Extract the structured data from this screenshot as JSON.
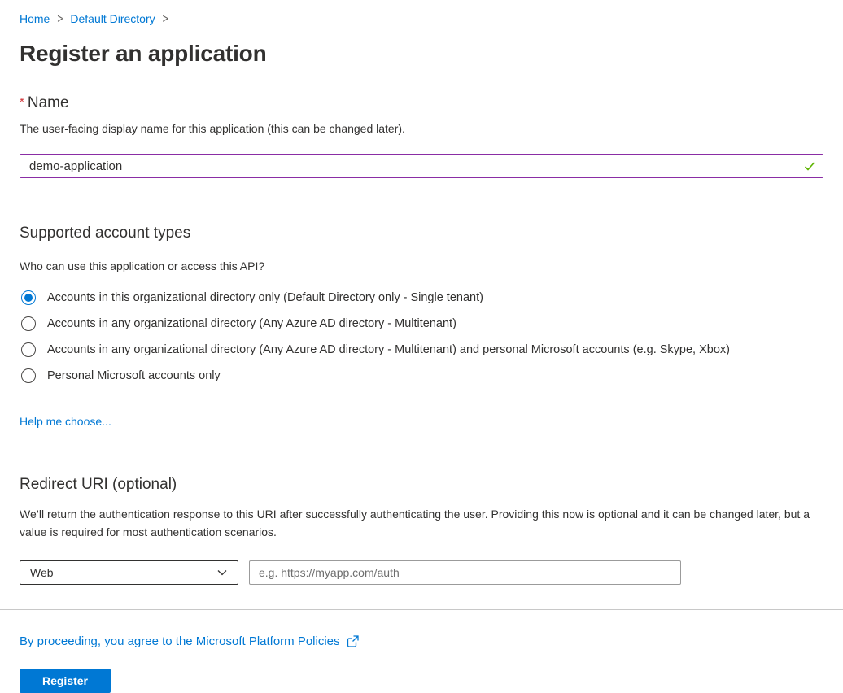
{
  "breadcrumb": {
    "items": [
      {
        "label": "Home"
      },
      {
        "label": "Default Directory"
      }
    ],
    "separator": ">"
  },
  "page": {
    "title": "Register an application"
  },
  "name_section": {
    "required_marker": "*",
    "label": "Name",
    "description": "The user-facing display name for this application (this can be changed later).",
    "value": "demo-application",
    "valid_icon": "green-checkmark-icon"
  },
  "account_section": {
    "heading": "Supported account types",
    "question": "Who can use this application or access this API?",
    "options": [
      {
        "label": "Accounts in this organizational directory only (Default Directory only - Single tenant)",
        "selected": true
      },
      {
        "label": "Accounts in any organizational directory (Any Azure AD directory - Multitenant)",
        "selected": false
      },
      {
        "label": "Accounts in any organizational directory (Any Azure AD directory - Multitenant) and personal Microsoft accounts (e.g. Skype, Xbox)",
        "selected": false
      },
      {
        "label": "Personal Microsoft accounts only",
        "selected": false
      }
    ],
    "help_link": "Help me choose..."
  },
  "redirect_section": {
    "heading": "Redirect URI (optional)",
    "description": "We’ll return the authentication response to this URI after successfully authenticating the user. Providing this now is optional and it can be changed later, but a value is required for most authentication scenarios.",
    "platform_value": "Web",
    "uri_placeholder": "e.g. https://myapp.com/auth"
  },
  "footer": {
    "policy_link_text": "By proceeding, you agree to the Microsoft Platform Policies",
    "external_link_icon": "external-link-icon",
    "register_label": "Register"
  },
  "colors": {
    "accent_blue": "#0078d4",
    "text_primary": "#323130",
    "name_input_border": "#8a2da5",
    "valid_green": "#5db300",
    "required_red": "#d13438",
    "divider_gray": "#c8c8c8"
  }
}
